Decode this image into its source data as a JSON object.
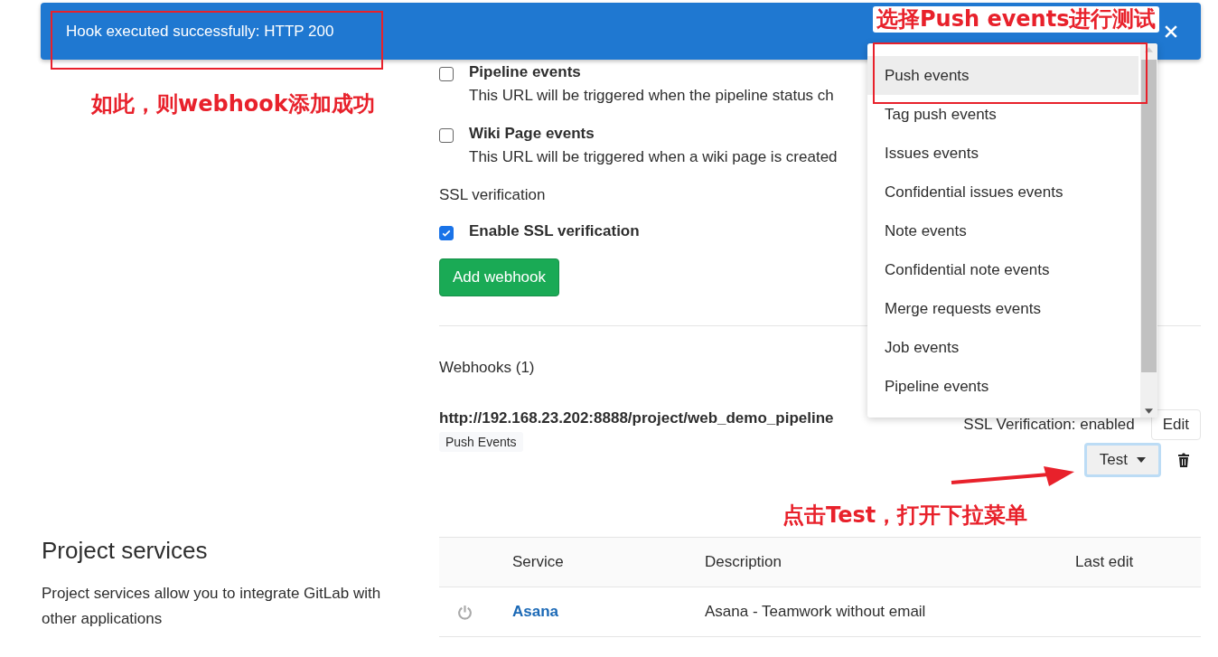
{
  "flash": {
    "message": "Hook executed successfully: HTTP 200"
  },
  "triggers": [
    {
      "label": "Pipeline events",
      "description": "This URL will be triggered when the pipeline status ch",
      "checked": false
    },
    {
      "label": "Wiki Page events",
      "description": "This URL will be triggered when a wiki page is created",
      "checked": false
    }
  ],
  "ssl": {
    "heading": "SSL verification",
    "label": "Enable SSL verification",
    "checked": true
  },
  "add_button": "Add webhook",
  "webhooks": {
    "heading": "Webhooks (1)",
    "items": [
      {
        "url": "http://192.168.23.202:8888/project/web_demo_pipeline",
        "badges": [
          "Push Events"
        ],
        "ssl_status": "SSL Verification: enabled",
        "edit": "Edit",
        "test": "Test"
      }
    ]
  },
  "test_menu": {
    "items": [
      {
        "label": "Push events",
        "selected": true
      },
      {
        "label": "Tag push events",
        "selected": false
      },
      {
        "label": "Issues events",
        "selected": false
      },
      {
        "label": "Confidential issues events",
        "selected": false
      },
      {
        "label": "Note events",
        "selected": false
      },
      {
        "label": "Confidential note events",
        "selected": false
      },
      {
        "label": "Merge requests events",
        "selected": false
      },
      {
        "label": "Job events",
        "selected": false
      },
      {
        "label": "Pipeline events",
        "selected": false
      }
    ]
  },
  "services": {
    "heading": "Project services",
    "description": "Project services allow you to integrate GitLab with other applications",
    "columns": [
      "Service",
      "Description",
      "Last edit"
    ],
    "rows": [
      {
        "service": "Asana",
        "description": "Asana - Teamwork without email"
      }
    ]
  },
  "annotations": [
    {
      "text": "如此，则webhook添加成功"
    },
    {
      "text": "选择Push events进行测试"
    },
    {
      "text": "点击Test，打开下拉菜单"
    }
  ]
}
